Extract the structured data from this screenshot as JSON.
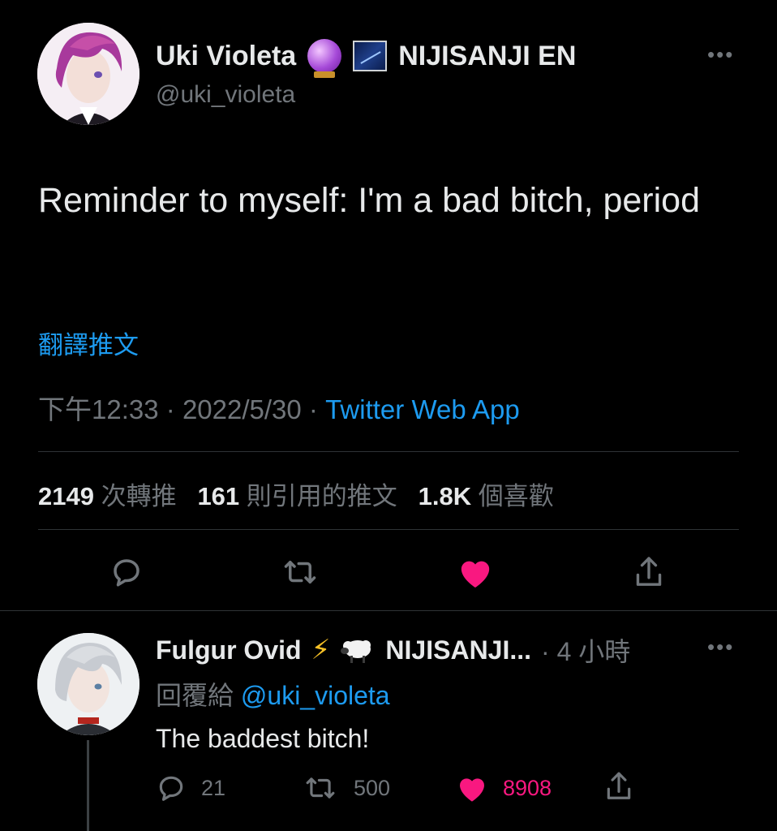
{
  "tweet": {
    "display_name": "Uki Violeta",
    "badge_org": "NIJISANJI EN",
    "handle": "@uki_violeta",
    "text": "Reminder to myself: I'm a bad bitch, period",
    "translate_label": "翻譯推文",
    "time": "下午12:33",
    "date": "2022/5/30",
    "source": "Twitter Web App",
    "retweets_count": "2149",
    "retweets_label": "次轉推",
    "quotes_count": "161",
    "quotes_label": "則引用的推文",
    "likes_count": "1.8K",
    "likes_label": "個喜歡",
    "more_icon": "more-icon"
  },
  "reply": {
    "display_name": "Fulgur Ovid",
    "org_truncated": "NIJISANJI...",
    "time": "4 小時",
    "reply_to_label": "回覆給",
    "reply_to_handle": "@uki_violeta",
    "text": "The baddest bitch!",
    "reply_count": "21",
    "retweet_count": "500",
    "like_count": "8908"
  },
  "colors": {
    "accent": "#1d9bf0",
    "like": "#f91880",
    "muted": "#71767b"
  }
}
